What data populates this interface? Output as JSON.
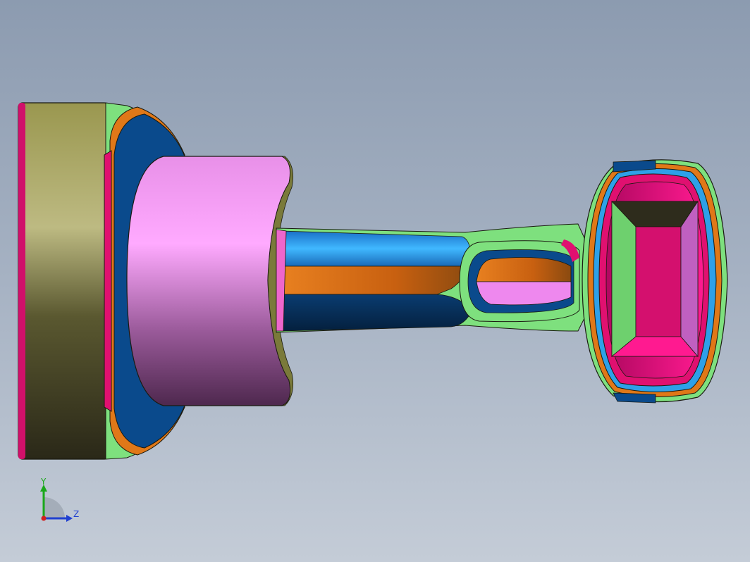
{
  "view": {
    "background_top": "#8c9bb0",
    "background_bottom": "#c4ccd7"
  },
  "model": {
    "type": "3d-cad-part",
    "face_colors": {
      "olive": "#8f8d48",
      "olive_light": "#b8b57c",
      "magenta": "#e01070",
      "orange": "#e07818",
      "navy": "#0a4a8c",
      "pink": "#ee88ee",
      "pink_dark": "#5a2c5a",
      "light_green": "#7ee07e",
      "cyan": "#2ea0e8",
      "dark_olive": "#2e2c1c"
    }
  },
  "triad": {
    "y_label": "Y",
    "z_label": "Z",
    "y_color": "#1aa81a",
    "z_color": "#2040d0",
    "x_color": "#d02020"
  }
}
